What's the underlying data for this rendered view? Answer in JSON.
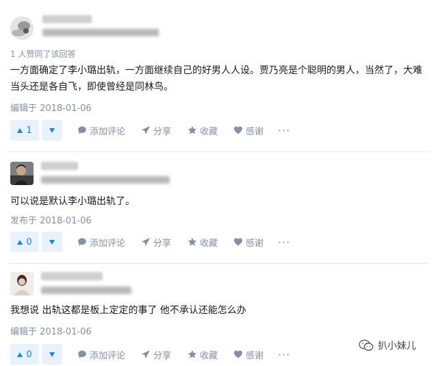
{
  "answers": [
    {
      "agree_text": "1 人赞同了该回答",
      "content": "一方面确定了李小璐出轨，一方面继续自己的好男人人设。贾乃亮是个聪明的男人，当然了，大难当头还是各自飞，即使曾经是同林鸟。",
      "date": "编辑于 2018-01-06",
      "votes": "1"
    },
    {
      "content": "可以说是默认李小璐出轨了。",
      "date": "发布于 2018-01-06",
      "votes": "0"
    },
    {
      "content": "我想说 出轨这都是板上定定的事了 他不承认还能怎么办",
      "date": "编辑于 2018-01-06",
      "votes": "0"
    }
  ],
  "actions": {
    "comment": "添加评论",
    "share": "分享",
    "collect": "收藏",
    "thanks": "感谢",
    "more": "···"
  },
  "watermark": {
    "text": "扒小妹儿"
  },
  "colors": {
    "accent": "#0f88eb",
    "vote_bg": "#e8f1fc",
    "meta": "#8590a6"
  }
}
